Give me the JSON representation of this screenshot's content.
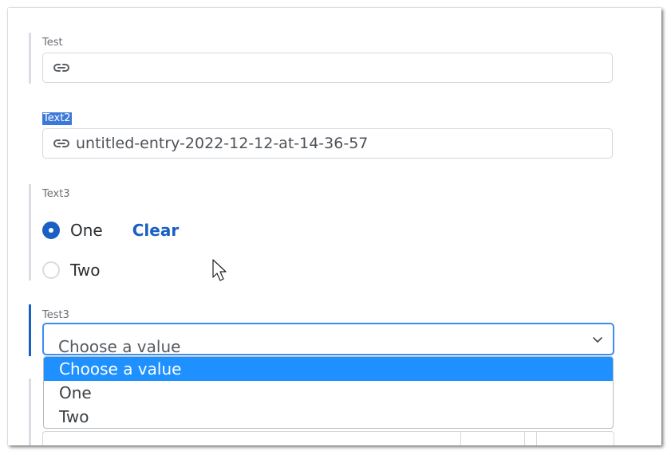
{
  "fields": [
    {
      "label": "Test",
      "value": ""
    },
    {
      "label": "Text2",
      "value": "untitled-entry-2022-12-12-at-14-36-57"
    }
  ],
  "radio_group": {
    "label": "Text3",
    "options": [
      {
        "label": "One",
        "checked": true
      },
      {
        "label": "Two",
        "checked": false
      }
    ],
    "clear_label": "Clear"
  },
  "select": {
    "label": "Test3",
    "value": "Choose a value",
    "options": [
      "Choose a value",
      "One",
      "Two"
    ],
    "highlighted_index": 0
  },
  "colors": {
    "accent": "#1a5fc3",
    "focus_border": "#3c8df0",
    "highlight": "#1e90ff"
  },
  "icons": {
    "link": "link-icon",
    "chevron": "chevron-down-icon",
    "cursor": "mouse-pointer-icon"
  }
}
